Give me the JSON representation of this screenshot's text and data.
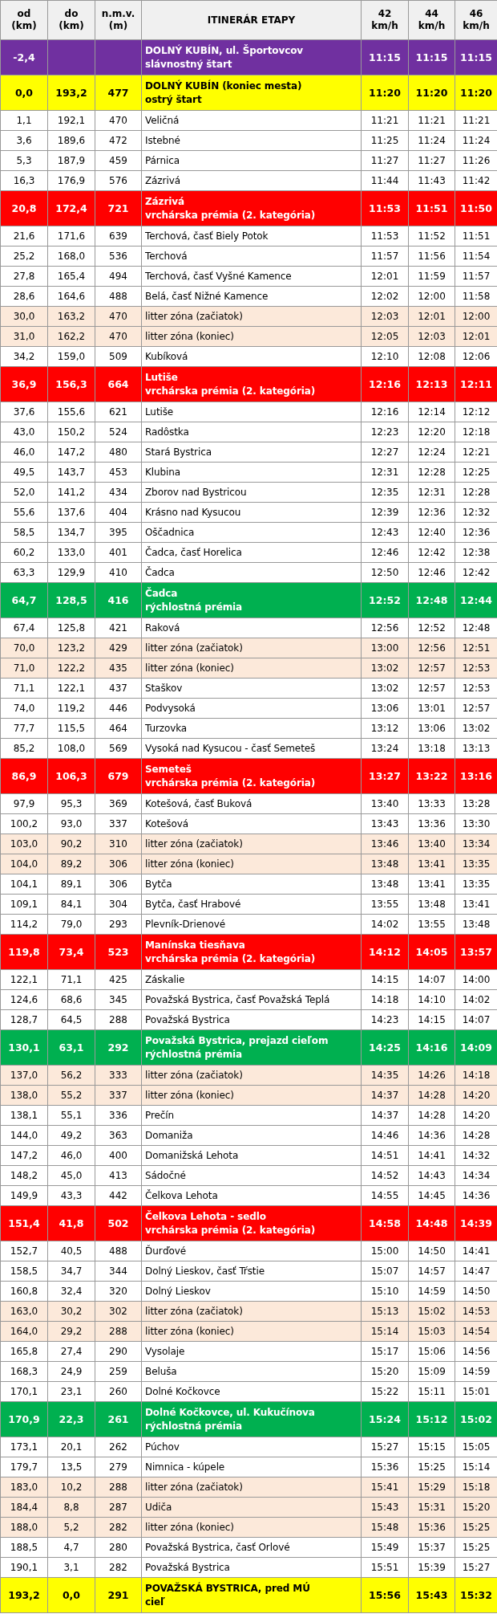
{
  "table": {
    "columns": [
      [
        "od",
        "(km)"
      ],
      [
        "do",
        "(km)"
      ],
      [
        "n.m.v.",
        "(m)"
      ],
      [
        "ITINERÁR ETAPY"
      ],
      [
        "42",
        "km/h"
      ],
      [
        "44",
        "km/h"
      ],
      [
        "46",
        "km/h"
      ]
    ],
    "rows": [
      {
        "kind": "neutral",
        "od": "-2,4",
        "itinerary": [
          "DOLNÝ KUBÍN, ul. Športovcov",
          "slávnostný štart"
        ],
        "times": [
          "11:15",
          "11:15",
          "11:15"
        ]
      },
      {
        "kind": "start",
        "od": "0,0",
        "do": "193,2",
        "nmv": "477",
        "itinerary": [
          "DOLNÝ KUBÍN (koniec mesta)",
          "ostrý štart"
        ],
        "times": [
          "11:20",
          "11:20",
          "11:20"
        ]
      },
      {
        "kind": "place",
        "od": "1,1",
        "do": "192,1",
        "nmv": "470",
        "itinerary": [
          "Veličná"
        ],
        "times": [
          "11:21",
          "11:21",
          "11:21"
        ]
      },
      {
        "kind": "place",
        "od": "3,6",
        "do": "189,6",
        "nmv": "472",
        "itinerary": [
          "Istebné"
        ],
        "times": [
          "11:25",
          "11:24",
          "11:24"
        ]
      },
      {
        "kind": "place",
        "od": "5,3",
        "do": "187,9",
        "nmv": "459",
        "itinerary": [
          "Párnica"
        ],
        "times": [
          "11:27",
          "11:27",
          "11:26"
        ]
      },
      {
        "kind": "place",
        "od": "16,3",
        "do": "176,9",
        "nmv": "576",
        "itinerary": [
          "Zázrivá"
        ],
        "times": [
          "11:44",
          "11:43",
          "11:42"
        ]
      },
      {
        "kind": "climb",
        "od": "20,8",
        "do": "172,4",
        "nmv": "721",
        "itinerary": [
          "Zázrivá",
          "vrchárska prémia (2. kategória)"
        ],
        "times": [
          "11:53",
          "11:51",
          "11:50"
        ]
      },
      {
        "kind": "place",
        "od": "21,6",
        "do": "171,6",
        "nmv": "639",
        "itinerary": [
          "Terchová, časť Biely Potok"
        ],
        "times": [
          "11:53",
          "11:52",
          "11:51"
        ]
      },
      {
        "kind": "place",
        "od": "25,2",
        "do": "168,0",
        "nmv": "536",
        "itinerary": [
          "Terchová"
        ],
        "times": [
          "11:57",
          "11:56",
          "11:54"
        ]
      },
      {
        "kind": "place",
        "od": "27,8",
        "do": "165,4",
        "nmv": "494",
        "itinerary": [
          "Terchová, časť Vyšné Kamence"
        ],
        "times": [
          "12:01",
          "11:59",
          "11:57"
        ]
      },
      {
        "kind": "place",
        "od": "28,6",
        "do": "164,6",
        "nmv": "488",
        "itinerary": [
          "Belá, časť Nižné Kamence"
        ],
        "times": [
          "12:02",
          "12:00",
          "11:58"
        ]
      },
      {
        "kind": "zone",
        "od": "30,0",
        "do": "163,2",
        "nmv": "470",
        "itinerary": [
          "litter zóna (začiatok)"
        ],
        "times": [
          "12:03",
          "12:01",
          "12:00"
        ]
      },
      {
        "kind": "zone",
        "od": "31,0",
        "do": "162,2",
        "nmv": "470",
        "itinerary": [
          "litter zóna (koniec)"
        ],
        "times": [
          "12:05",
          "12:03",
          "12:01"
        ]
      },
      {
        "kind": "place",
        "od": "34,2",
        "do": "159,0",
        "nmv": "509",
        "itinerary": [
          "Kubíková"
        ],
        "times": [
          "12:10",
          "12:08",
          "12:06"
        ]
      },
      {
        "kind": "climb",
        "od": "36,9",
        "do": "156,3",
        "nmv": "664",
        "itinerary": [
          "Lutiše",
          "vrchárska prémia (2. kategória)"
        ],
        "times": [
          "12:16",
          "12:13",
          "12:11"
        ]
      },
      {
        "kind": "place",
        "od": "37,6",
        "do": "155,6",
        "nmv": "621",
        "itinerary": [
          "Lutiše"
        ],
        "times": [
          "12:16",
          "12:14",
          "12:12"
        ]
      },
      {
        "kind": "place",
        "od": "43,0",
        "do": "150,2",
        "nmv": "524",
        "itinerary": [
          "Radôstka"
        ],
        "times": [
          "12:23",
          "12:20",
          "12:18"
        ]
      },
      {
        "kind": "place",
        "od": "46,0",
        "do": "147,2",
        "nmv": "480",
        "itinerary": [
          "Stará Bystrica"
        ],
        "times": [
          "12:27",
          "12:24",
          "12:21"
        ]
      },
      {
        "kind": "place",
        "od": "49,5",
        "do": "143,7",
        "nmv": "453",
        "itinerary": [
          "Klubina"
        ],
        "times": [
          "12:31",
          "12:28",
          "12:25"
        ]
      },
      {
        "kind": "place",
        "od": "52,0",
        "do": "141,2",
        "nmv": "434",
        "itinerary": [
          "Zborov nad Bystricou"
        ],
        "times": [
          "12:35",
          "12:31",
          "12:28"
        ]
      },
      {
        "kind": "place",
        "od": "55,6",
        "do": "137,6",
        "nmv": "404",
        "itinerary": [
          "Krásno nad Kysucou"
        ],
        "times": [
          "12:39",
          "12:36",
          "12:32"
        ]
      },
      {
        "kind": "place",
        "od": "58,5",
        "do": "134,7",
        "nmv": "395",
        "itinerary": [
          "Oščadnica"
        ],
        "times": [
          "12:43",
          "12:40",
          "12:36"
        ]
      },
      {
        "kind": "place",
        "od": "60,2",
        "do": "133,0",
        "nmv": "401",
        "itinerary": [
          "Čadca, časť Horelica"
        ],
        "times": [
          "12:46",
          "12:42",
          "12:38"
        ]
      },
      {
        "kind": "place",
        "od": "63,3",
        "do": "129,9",
        "nmv": "410",
        "itinerary": [
          "Čadca"
        ],
        "times": [
          "12:50",
          "12:46",
          "12:42"
        ]
      },
      {
        "kind": "sprint",
        "od": "64,7",
        "do": "128,5",
        "nmv": "416",
        "itinerary": [
          "Čadca",
          "rýchlostná prémia"
        ],
        "times": [
          "12:52",
          "12:48",
          "12:44"
        ]
      },
      {
        "kind": "place",
        "od": "67,4",
        "do": "125,8",
        "nmv": "421",
        "itinerary": [
          "Raková"
        ],
        "times": [
          "12:56",
          "12:52",
          "12:48"
        ]
      },
      {
        "kind": "zone",
        "od": "70,0",
        "do": "123,2",
        "nmv": "429",
        "itinerary": [
          "litter zóna (začiatok)"
        ],
        "times": [
          "13:00",
          "12:56",
          "12:51"
        ]
      },
      {
        "kind": "zone",
        "od": "71,0",
        "do": "122,2",
        "nmv": "435",
        "itinerary": [
          "litter zóna (koniec)"
        ],
        "times": [
          "13:02",
          "12:57",
          "12:53"
        ]
      },
      {
        "kind": "place",
        "od": "71,1",
        "do": "122,1",
        "nmv": "437",
        "itinerary": [
          "Staškov"
        ],
        "times": [
          "13:02",
          "12:57",
          "12:53"
        ]
      },
      {
        "kind": "place",
        "od": "74,0",
        "do": "119,2",
        "nmv": "446",
        "itinerary": [
          "Podvysoká"
        ],
        "times": [
          "13:06",
          "13:01",
          "12:57"
        ]
      },
      {
        "kind": "place",
        "od": "77,7",
        "do": "115,5",
        "nmv": "464",
        "itinerary": [
          "Turzovka"
        ],
        "times": [
          "13:12",
          "13:06",
          "13:02"
        ]
      },
      {
        "kind": "place",
        "od": "85,2",
        "do": "108,0",
        "nmv": "569",
        "itinerary": [
          "Vysoká nad Kysucou - časť Semeteš"
        ],
        "times": [
          "13:24",
          "13:18",
          "13:13"
        ]
      },
      {
        "kind": "climb",
        "od": "86,9",
        "do": "106,3",
        "nmv": "679",
        "itinerary": [
          "Semeteš",
          "vrchárska prémia (2. kategória)"
        ],
        "times": [
          "13:27",
          "13:22",
          "13:16"
        ]
      },
      {
        "kind": "place",
        "od": "97,9",
        "do": "95,3",
        "nmv": "369",
        "itinerary": [
          "Kotešová, časť Buková"
        ],
        "times": [
          "13:40",
          "13:33",
          "13:28"
        ]
      },
      {
        "kind": "place",
        "od": "100,2",
        "do": "93,0",
        "nmv": "337",
        "itinerary": [
          "Kotešová"
        ],
        "times": [
          "13:43",
          "13:36",
          "13:30"
        ]
      },
      {
        "kind": "zone",
        "od": "103,0",
        "do": "90,2",
        "nmv": "310",
        "itinerary": [
          "litter zóna (začiatok)"
        ],
        "times": [
          "13:46",
          "13:40",
          "13:34"
        ]
      },
      {
        "kind": "zone",
        "od": "104,0",
        "do": "89,2",
        "nmv": "306",
        "itinerary": [
          "litter zóna (koniec)"
        ],
        "times": [
          "13:48",
          "13:41",
          "13:35"
        ]
      },
      {
        "kind": "place",
        "od": "104,1",
        "do": "89,1",
        "nmv": "306",
        "itinerary": [
          "Bytča"
        ],
        "times": [
          "13:48",
          "13:41",
          "13:35"
        ]
      },
      {
        "kind": "place",
        "od": "109,1",
        "do": "84,1",
        "nmv": "304",
        "itinerary": [
          "Bytča, časť Hrabové"
        ],
        "times": [
          "13:55",
          "13:48",
          "13:41"
        ]
      },
      {
        "kind": "place",
        "od": "114,2",
        "do": "79,0",
        "nmv": "293",
        "itinerary": [
          "Plevník-Drienové"
        ],
        "times": [
          "14:02",
          "13:55",
          "13:48"
        ]
      },
      {
        "kind": "climb",
        "od": "119,8",
        "do": "73,4",
        "nmv": "523",
        "itinerary": [
          "Manínska tiesňava",
          "vrchárska prémia (2. kategória)"
        ],
        "times": [
          "14:12",
          "14:05",
          "13:57"
        ]
      },
      {
        "kind": "place",
        "od": "122,1",
        "do": "71,1",
        "nmv": "425",
        "itinerary": [
          "Záskalie"
        ],
        "times": [
          "14:15",
          "14:07",
          "14:00"
        ]
      },
      {
        "kind": "place",
        "od": "124,6",
        "do": "68,6",
        "nmv": "345",
        "itinerary": [
          "Považská Bystrica, časť Považská Teplá"
        ],
        "times": [
          "14:18",
          "14:10",
          "14:02"
        ]
      },
      {
        "kind": "place",
        "od": "128,7",
        "do": "64,5",
        "nmv": "288",
        "itinerary": [
          "Považská Bystrica"
        ],
        "times": [
          "14:23",
          "14:15",
          "14:07"
        ]
      },
      {
        "kind": "sprint",
        "od": "130,1",
        "do": "63,1",
        "nmv": "292",
        "itinerary": [
          "Považská Bystrica, prejazd cieľom",
          "rýchlostná prémia"
        ],
        "times": [
          "14:25",
          "14:16",
          "14:09"
        ]
      },
      {
        "kind": "zone",
        "od": "137,0",
        "do": "56,2",
        "nmv": "333",
        "itinerary": [
          "litter zóna (začiatok)"
        ],
        "times": [
          "14:35",
          "14:26",
          "14:18"
        ]
      },
      {
        "kind": "zone",
        "od": "138,0",
        "do": "55,2",
        "nmv": "337",
        "itinerary": [
          "litter zóna (koniec)"
        ],
        "times": [
          "14:37",
          "14:28",
          "14:20"
        ]
      },
      {
        "kind": "place",
        "od": "138,1",
        "do": "55,1",
        "nmv": "336",
        "itinerary": [
          "Prečín"
        ],
        "times": [
          "14:37",
          "14:28",
          "14:20"
        ]
      },
      {
        "kind": "place",
        "od": "144,0",
        "do": "49,2",
        "nmv": "363",
        "itinerary": [
          "Domaniža"
        ],
        "times": [
          "14:46",
          "14:36",
          "14:28"
        ]
      },
      {
        "kind": "place",
        "od": "147,2",
        "do": "46,0",
        "nmv": "400",
        "itinerary": [
          "Domanižská Lehota"
        ],
        "times": [
          "14:51",
          "14:41",
          "14:32"
        ]
      },
      {
        "kind": "place",
        "od": "148,2",
        "do": "45,0",
        "nmv": "413",
        "itinerary": [
          "Sádočné"
        ],
        "times": [
          "14:52",
          "14:43",
          "14:34"
        ]
      },
      {
        "kind": "place",
        "od": "149,9",
        "do": "43,3",
        "nmv": "442",
        "itinerary": [
          "Čelkova Lehota"
        ],
        "times": [
          "14:55",
          "14:45",
          "14:36"
        ]
      },
      {
        "kind": "climb",
        "od": "151,4",
        "do": "41,8",
        "nmv": "502",
        "itinerary": [
          "Čelkova Lehota - sedlo",
          "vrchárska prémia (2. kategória)"
        ],
        "times": [
          "14:58",
          "14:48",
          "14:39"
        ]
      },
      {
        "kind": "place",
        "od": "152,7",
        "do": "40,5",
        "nmv": "488",
        "itinerary": [
          "Ďurďové"
        ],
        "times": [
          "15:00",
          "14:50",
          "14:41"
        ]
      },
      {
        "kind": "place",
        "od": "158,5",
        "do": "34,7",
        "nmv": "344",
        "itinerary": [
          "Dolný Lieskov, časť Tŕstie"
        ],
        "times": [
          "15:07",
          "14:57",
          "14:47"
        ]
      },
      {
        "kind": "place",
        "od": "160,8",
        "do": "32,4",
        "nmv": "320",
        "itinerary": [
          "Dolný Lieskov"
        ],
        "times": [
          "15:10",
          "14:59",
          "14:50"
        ]
      },
      {
        "kind": "zone",
        "od": "163,0",
        "do": "30,2",
        "nmv": "302",
        "itinerary": [
          "litter zóna (začiatok)"
        ],
        "times": [
          "15:13",
          "15:02",
          "14:53"
        ]
      },
      {
        "kind": "zone",
        "od": "164,0",
        "do": "29,2",
        "nmv": "288",
        "itinerary": [
          "litter zóna (koniec)"
        ],
        "times": [
          "15:14",
          "15:03",
          "14:54"
        ]
      },
      {
        "kind": "place",
        "od": "165,8",
        "do": "27,4",
        "nmv": "290",
        "itinerary": [
          "Vysolaje"
        ],
        "times": [
          "15:17",
          "15:06",
          "14:56"
        ]
      },
      {
        "kind": "place",
        "od": "168,3",
        "do": "24,9",
        "nmv": "259",
        "itinerary": [
          "Beluša"
        ],
        "times": [
          "15:20",
          "15:09",
          "14:59"
        ]
      },
      {
        "kind": "place",
        "od": "170,1",
        "do": "23,1",
        "nmv": "260",
        "itinerary": [
          "Dolné Kočkovce"
        ],
        "times": [
          "15:22",
          "15:11",
          "15:01"
        ]
      },
      {
        "kind": "sprint",
        "od": "170,9",
        "do": "22,3",
        "nmv": "261",
        "itinerary": [
          "Dolné Kočkovce, ul. Kukučínova",
          "rýchlostná prémia"
        ],
        "times": [
          "15:24",
          "15:12",
          "15:02"
        ]
      },
      {
        "kind": "place",
        "od": "173,1",
        "do": "20,1",
        "nmv": "262",
        "itinerary": [
          "Púchov"
        ],
        "times": [
          "15:27",
          "15:15",
          "15:05"
        ]
      },
      {
        "kind": "place",
        "od": "179,7",
        "do": "13,5",
        "nmv": "279",
        "itinerary": [
          "Nimnica - kúpele"
        ],
        "times": [
          "15:36",
          "15:25",
          "15:14"
        ]
      },
      {
        "kind": "zone",
        "od": "183,0",
        "do": "10,2",
        "nmv": "288",
        "itinerary": [
          "litter zóna (začiatok)"
        ],
        "times": [
          "15:41",
          "15:29",
          "15:18"
        ]
      },
      {
        "kind": "zone",
        "od": "184,4",
        "do": "8,8",
        "nmv": "287",
        "itinerary": [
          "Udiča"
        ],
        "times": [
          "15:43",
          "15:31",
          "15:20"
        ]
      },
      {
        "kind": "zone",
        "od": "188,0",
        "do": "5,2",
        "nmv": "282",
        "itinerary": [
          "litter zóna (koniec)"
        ],
        "times": [
          "15:48",
          "15:36",
          "15:25"
        ]
      },
      {
        "kind": "place",
        "od": "188,5",
        "do": "4,7",
        "nmv": "280",
        "itinerary": [
          "Považská Bystrica, časť Orlové"
        ],
        "times": [
          "15:49",
          "15:37",
          "15:25"
        ]
      },
      {
        "kind": "place",
        "od": "190,1",
        "do": "3,1",
        "nmv": "282",
        "itinerary": [
          "Považská Bystrica"
        ],
        "times": [
          "15:51",
          "15:39",
          "15:27"
        ]
      },
      {
        "kind": "finish",
        "od": "193,2",
        "do": "0,0",
        "nmv": "291",
        "itinerary": [
          "POVAŽSKÁ BYSTRICA, pred MÚ",
          "cieľ"
        ],
        "times": [
          "15:56",
          "15:43",
          "15:32"
        ]
      }
    ]
  }
}
